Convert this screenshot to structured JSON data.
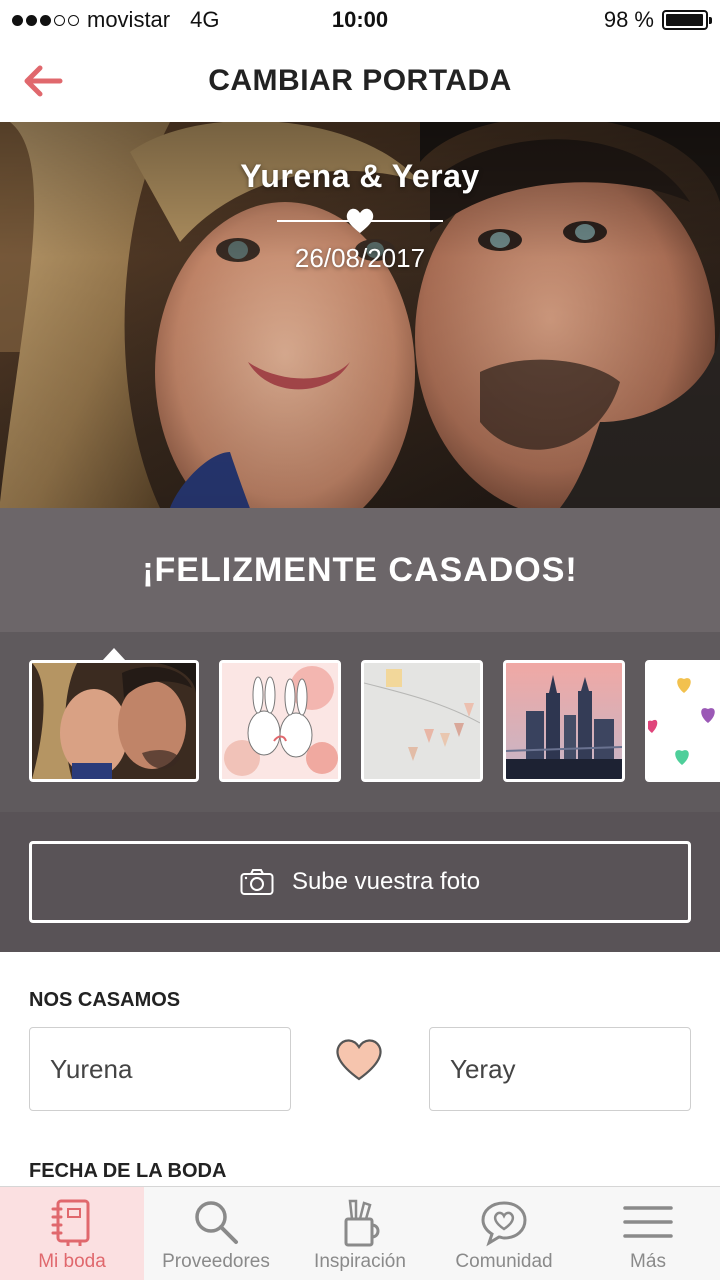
{
  "status_bar": {
    "carrier": "movistar",
    "network": "4G",
    "time": "10:00",
    "battery": "98 %",
    "battery_level": 0.98,
    "signal_bars": 3,
    "signal_max": 5
  },
  "nav": {
    "title": "CAMBIAR PORTADA",
    "back_icon": "back-arrow-icon",
    "accent_color": "#e0686d"
  },
  "cover": {
    "names": "Yurena & Yeray",
    "date": "26/08/2017"
  },
  "banner": {
    "text": "¡FELIZMENTE CASADOS!"
  },
  "thumbnails": [
    {
      "name": "couple-selfie",
      "selected": true
    },
    {
      "name": "bunnies-illustration",
      "selected": false
    },
    {
      "name": "paper-bunting",
      "selected": false
    },
    {
      "name": "city-skyline",
      "selected": false
    },
    {
      "name": "colorful-hearts",
      "selected": false
    }
  ],
  "upload": {
    "label": "Sube vuestra foto",
    "icon": "camera-icon"
  },
  "form": {
    "section_title": "NOS CASAMOS",
    "partner1": "Yurena",
    "partner2": "Yeray",
    "date_section_title": "FECHA DE LA BODA"
  },
  "tabbar": {
    "items": [
      {
        "label": "Mi boda",
        "icon": "notebook-icon",
        "active": true
      },
      {
        "label": "Proveedores",
        "icon": "search-icon",
        "active": false
      },
      {
        "label": "Inspiración",
        "icon": "pencil-cup-icon",
        "active": false
      },
      {
        "label": "Comunidad",
        "icon": "chat-heart-icon",
        "active": false
      },
      {
        "label": "Más",
        "icon": "menu-icon",
        "active": false
      }
    ]
  }
}
